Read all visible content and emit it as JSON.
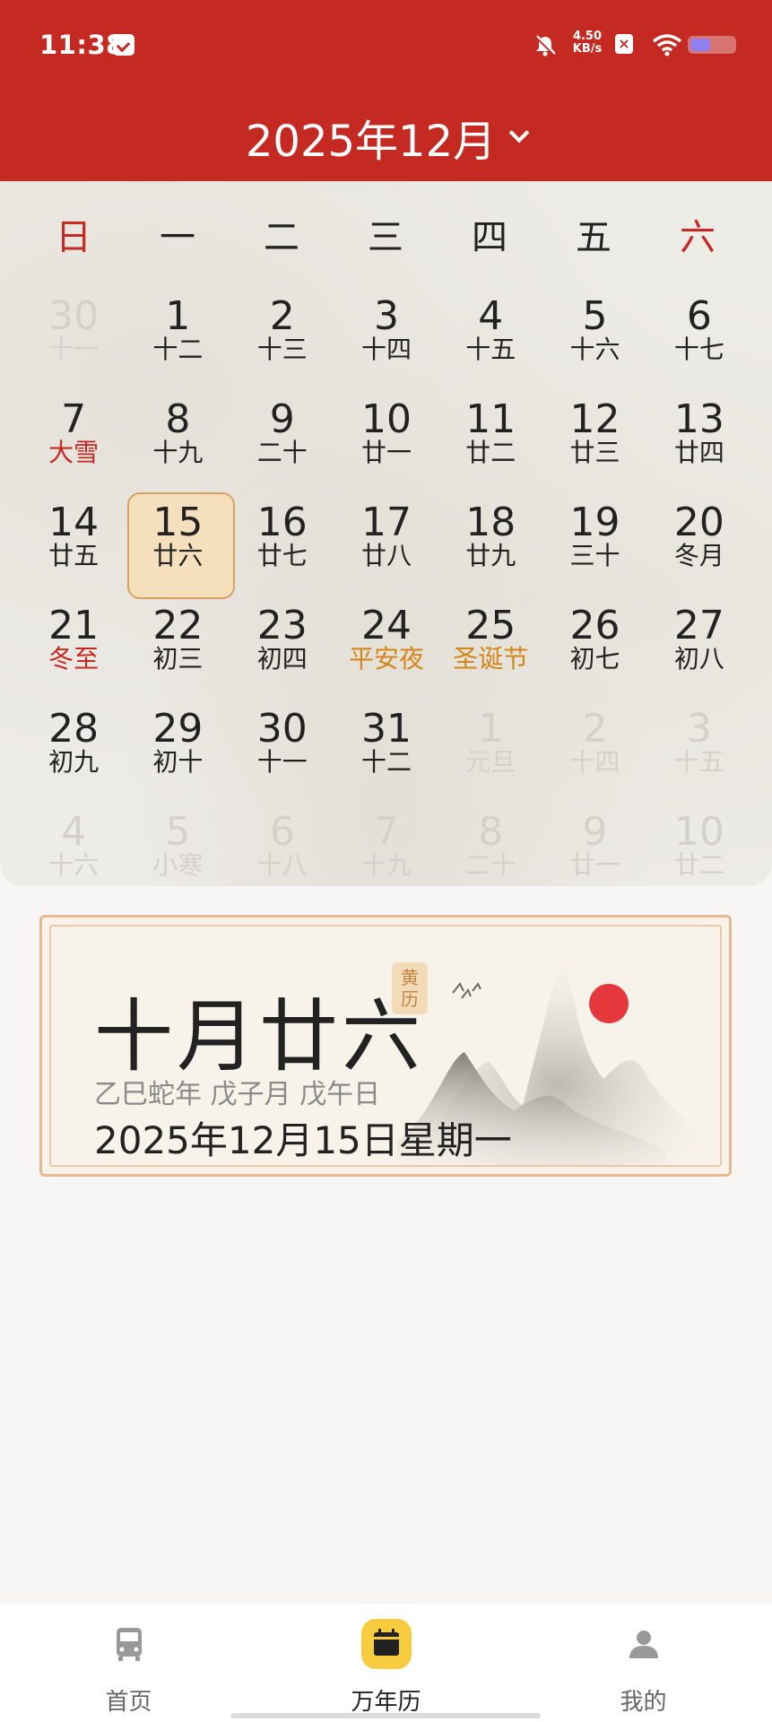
{
  "status_bar": {
    "time": "11:38",
    "net_speed_value": "4.50",
    "net_speed_unit": "KB/s",
    "icons": [
      "message-icon",
      "mute-bell-icon",
      "x-icon",
      "wifi-icon",
      "battery-icon"
    ]
  },
  "header": {
    "month_title": "2025年12月",
    "background_color": "#c42a22"
  },
  "weekdays": [
    "日",
    "一",
    "二",
    "三",
    "四",
    "五",
    "六"
  ],
  "calendar_rows": [
    [
      {
        "num": "30",
        "lunar": "十一",
        "muted": true
      },
      {
        "num": "1",
        "lunar": "十二"
      },
      {
        "num": "2",
        "lunar": "十三"
      },
      {
        "num": "3",
        "lunar": "十四"
      },
      {
        "num": "4",
        "lunar": "十五"
      },
      {
        "num": "5",
        "lunar": "十六"
      },
      {
        "num": "6",
        "lunar": "十七"
      }
    ],
    [
      {
        "num": "7",
        "lunar": "大雪",
        "festival": "red"
      },
      {
        "num": "8",
        "lunar": "十九"
      },
      {
        "num": "9",
        "lunar": "二十"
      },
      {
        "num": "10",
        "lunar": "廿一"
      },
      {
        "num": "11",
        "lunar": "廿二"
      },
      {
        "num": "12",
        "lunar": "廿三"
      },
      {
        "num": "13",
        "lunar": "廿四"
      }
    ],
    [
      {
        "num": "14",
        "lunar": "廿五"
      },
      {
        "num": "15",
        "lunar": "廿六",
        "selected": true
      },
      {
        "num": "16",
        "lunar": "廿七"
      },
      {
        "num": "17",
        "lunar": "廿八"
      },
      {
        "num": "18",
        "lunar": "廿九"
      },
      {
        "num": "19",
        "lunar": "三十"
      },
      {
        "num": "20",
        "lunar": "冬月"
      }
    ],
    [
      {
        "num": "21",
        "lunar": "冬至",
        "festival": "red"
      },
      {
        "num": "22",
        "lunar": "初三"
      },
      {
        "num": "23",
        "lunar": "初四"
      },
      {
        "num": "24",
        "lunar": "平安夜",
        "festival": "gold"
      },
      {
        "num": "25",
        "lunar": "圣诞节",
        "festival": "gold"
      },
      {
        "num": "26",
        "lunar": "初七"
      },
      {
        "num": "27",
        "lunar": "初八"
      }
    ],
    [
      {
        "num": "28",
        "lunar": "初九"
      },
      {
        "num": "29",
        "lunar": "初十"
      },
      {
        "num": "30",
        "lunar": "十一"
      },
      {
        "num": "31",
        "lunar": "十二"
      },
      {
        "num": "1",
        "lunar": "元旦",
        "muted": true
      },
      {
        "num": "2",
        "lunar": "十四",
        "muted": true
      },
      {
        "num": "3",
        "lunar": "十五",
        "muted": true
      }
    ],
    [
      {
        "num": "4",
        "lunar": "十六",
        "muted": true
      },
      {
        "num": "5",
        "lunar": "小寒",
        "muted": true
      },
      {
        "num": "6",
        "lunar": "十八",
        "muted": true
      },
      {
        "num": "7",
        "lunar": "十九",
        "muted": true
      },
      {
        "num": "8",
        "lunar": "二十",
        "muted": true
      },
      {
        "num": "9",
        "lunar": "廿一",
        "muted": true
      },
      {
        "num": "10",
        "lunar": "廿二",
        "muted": true
      }
    ]
  ],
  "card": {
    "lunar_date": "十月廿六",
    "badge": "黄历",
    "ganzhi": "乙巳蛇年 戊子月 戊午日",
    "solar_date": "2025年12月15日星期一"
  },
  "bottom_nav": [
    {
      "label": "首页",
      "icon": "bus-icon",
      "active": false
    },
    {
      "label": "万年历",
      "icon": "calendar-icon",
      "active": true
    },
    {
      "label": "我的",
      "icon": "person-icon",
      "active": false
    }
  ],
  "colors": {
    "accent_red": "#c42a22",
    "festival_gold": "#d4861a",
    "selected_bg": "#f5dfbd",
    "nav_active": "#f7cc3f"
  }
}
